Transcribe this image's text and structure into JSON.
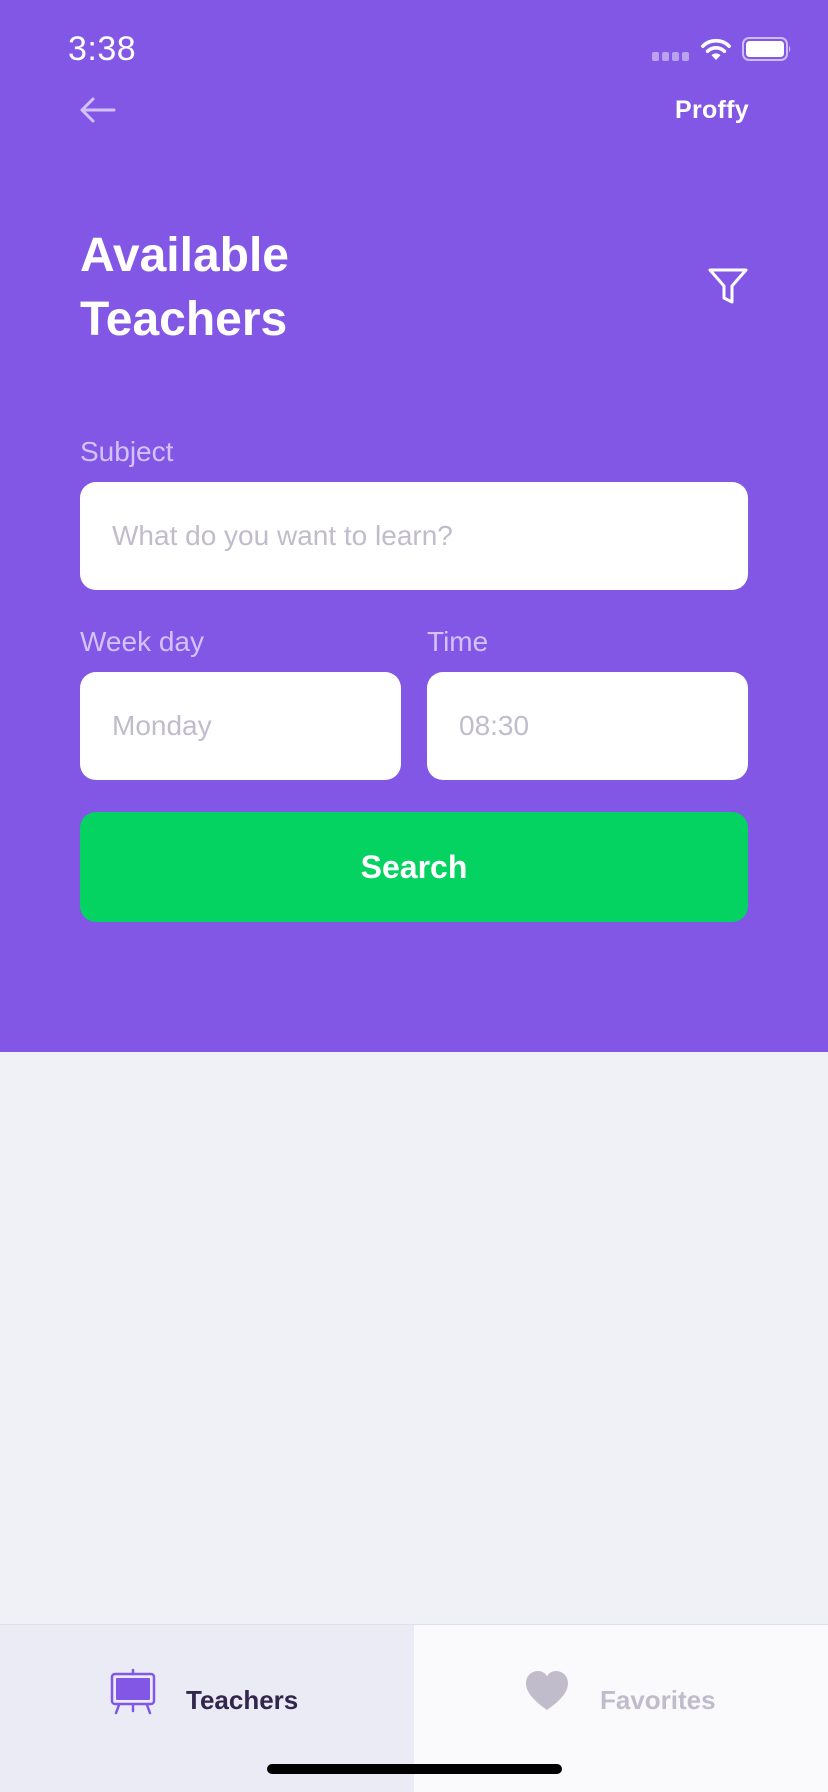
{
  "status_bar": {
    "time": "3:38"
  },
  "nav": {
    "brand": "Proffy"
  },
  "page": {
    "title": "Available Teachers"
  },
  "form": {
    "subject": {
      "label": "Subject",
      "placeholder": "What do you want to learn?"
    },
    "week_day": {
      "label": "Week day",
      "placeholder": "Monday"
    },
    "time": {
      "label": "Time",
      "placeholder": "08:30"
    },
    "search_label": "Search"
  },
  "tabs": [
    {
      "label": "Teachers",
      "icon": "easel-icon",
      "active": true
    },
    {
      "label": "Favorites",
      "icon": "heart-icon",
      "active": false
    }
  ],
  "colors": {
    "primary": "#8257E5",
    "success": "#04D361",
    "background": "#F0F0F7",
    "label": "#D4C2FF",
    "active_tab_text": "#32264D",
    "inactive_tab_text": "#C1BCCC"
  }
}
